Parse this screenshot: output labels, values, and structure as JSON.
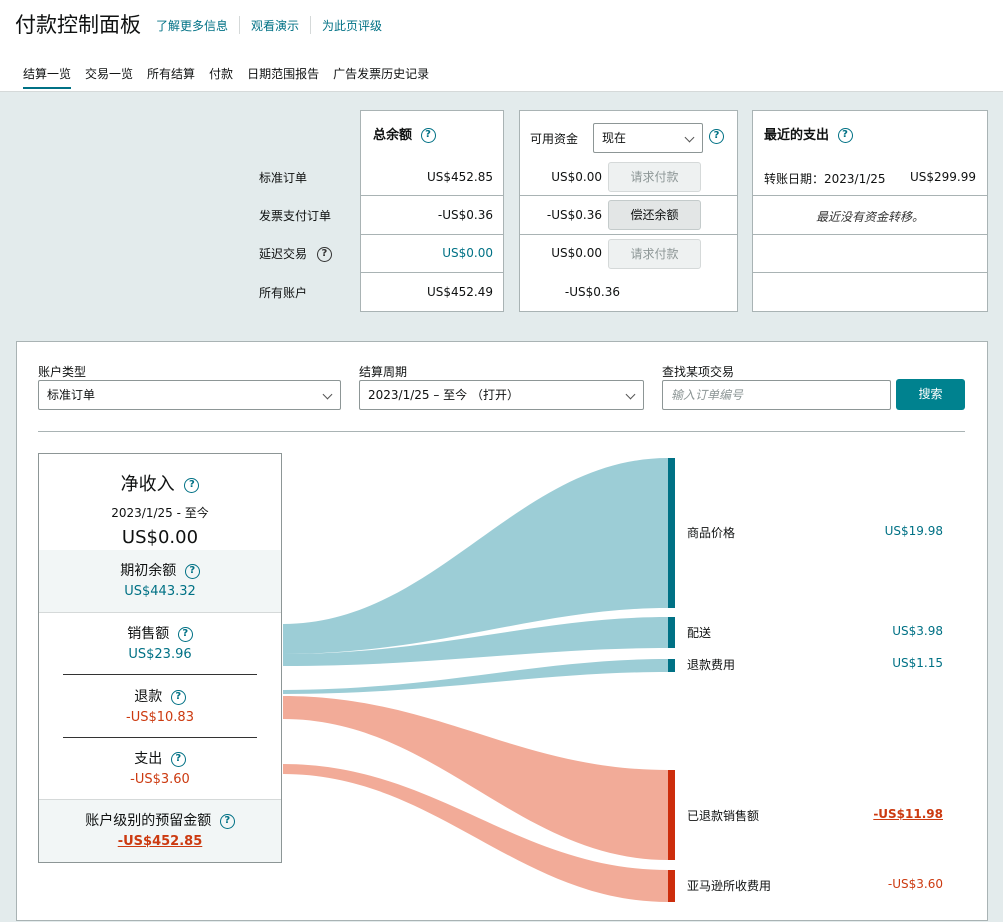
{
  "header": {
    "title": "付款控制面板",
    "links": [
      "了解更多信息",
      "观看演示",
      "为此页评级"
    ]
  },
  "nav": {
    "tabs": [
      "结算一览",
      "交易一览",
      "所有结算",
      "付款",
      "日期范围报告",
      "广告发票历史记录"
    ]
  },
  "rows": {
    "standard": "标准订单",
    "invoice": "发票支付订单",
    "deferred": "延迟交易",
    "all": "所有账户"
  },
  "total_balance": {
    "title": "总余额",
    "standard": "US$452.85",
    "invoice": "-US$0.36",
    "deferred": "US$0.00",
    "all": "US$452.49"
  },
  "available_funds": {
    "label": "可用资金",
    "selected": "现在",
    "standard": "US$0.00",
    "invoice": "-US$0.36",
    "deferred": "US$0.00",
    "all": "-US$0.36",
    "btn_request": "请求付款",
    "btn_repay": "偿还余额",
    "btn_request2": "请求付款"
  },
  "recent_payouts": {
    "title": "最近的支出",
    "transfer_label": "转账日期：",
    "transfer_date": "2023/1/25",
    "transfer_amount": "US$299.99",
    "no_transfer": "最近没有资金转移。"
  },
  "filters": {
    "account_type_label": "账户类型",
    "account_type_value": "标准订单",
    "period_label": "结算周期",
    "period_value": "2023/1/25 – 至今 （打开）",
    "search_label": "查找某项交易",
    "search_placeholder": "输入订单编号",
    "search_button": "搜索"
  },
  "summary": {
    "net_title": "净收入",
    "net_date": "2023/1/25 - 至今",
    "net_value": "US$0.00",
    "opening_title": "期初余额",
    "opening_value": "US$443.32",
    "sales_title": "销售额",
    "sales_value": "US$23.96",
    "refund_title": "退款",
    "refund_value": "-US$10.83",
    "expense_title": "支出",
    "expense_value": "-US$3.60",
    "reserve_title": "账户级别的预留金额",
    "reserve_value": "-US$452.85"
  },
  "flows": {
    "items": [
      {
        "label": "商品价格",
        "value": "US$19.98"
      },
      {
        "label": "配送",
        "value": "US$3.98"
      },
      {
        "label": "退款费用",
        "value": "US$1.15"
      },
      {
        "label": "已退款销售额",
        "value": "-US$11.98"
      },
      {
        "label": "亚马逊所收费用",
        "value": "-US$3.60"
      }
    ],
    "colors": {
      "positive": "#9ccdd6",
      "positive_bar": "#007185",
      "negative": "#f2ab98",
      "negative_bar": "#cc2d0c"
    }
  }
}
